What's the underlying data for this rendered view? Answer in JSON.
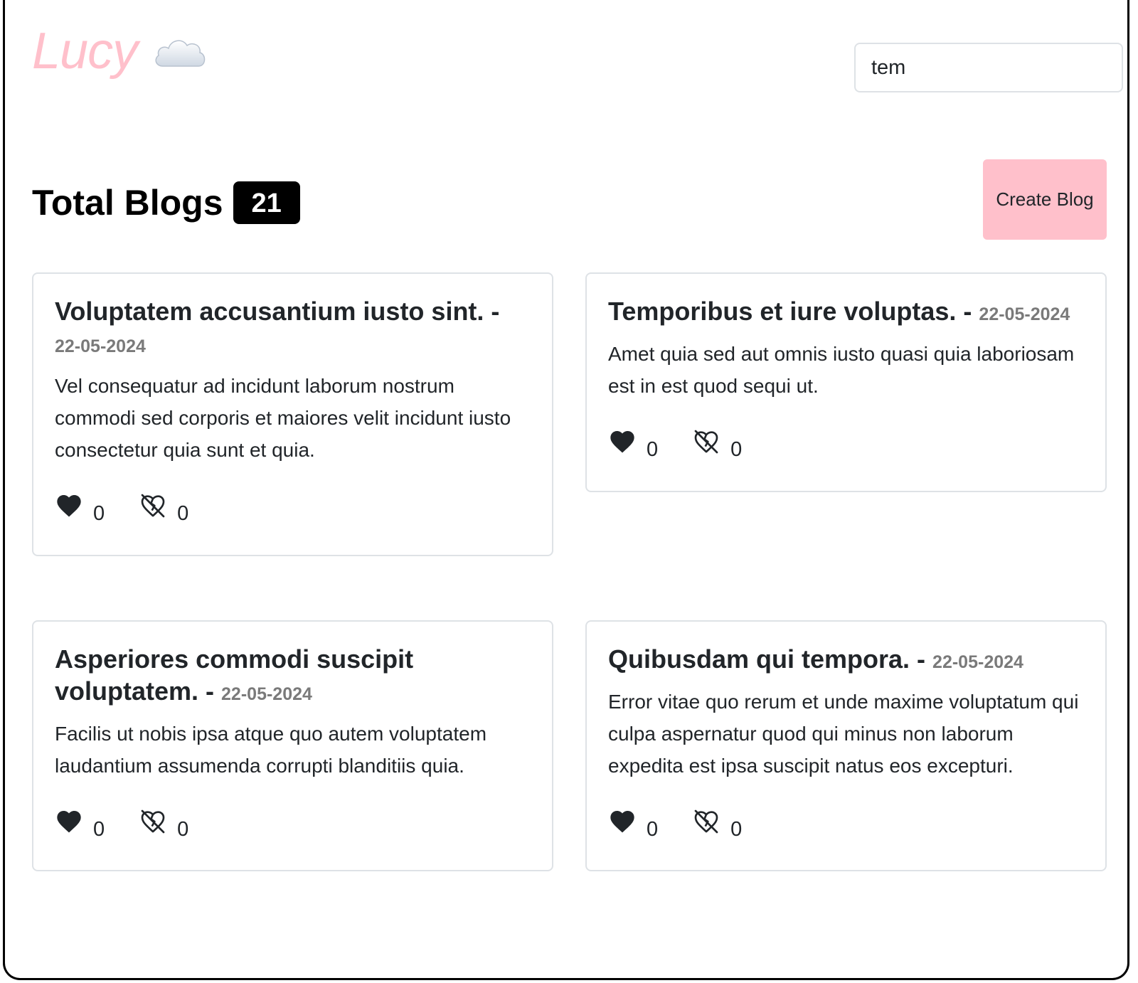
{
  "brand": {
    "name": "Lucy",
    "icon": "cloud-icon"
  },
  "search": {
    "value": "tem"
  },
  "header": {
    "title": "Total Blogs",
    "count": "21",
    "create_label": "Create Blog"
  },
  "colors": {
    "accent": "#ffc0cb",
    "badge": "#000000",
    "date": "#7a7a7a"
  },
  "blogs": [
    {
      "title": "Voluptatem accusantium iusto sint.",
      "separator": " - ",
      "date": "22-05-2024",
      "body": "Vel consequatur ad incidunt laborum nostrum commodi sed corporis et maiores velit incidunt iusto consectetur quia sunt et quia.",
      "likes": "0",
      "dislikes": "0"
    },
    {
      "title": "Temporibus et iure voluptas.",
      "separator": " - ",
      "date": "22-05-2024",
      "body": "Amet quia sed aut omnis iusto quasi quia laboriosam est in est quod sequi ut.",
      "likes": "0",
      "dislikes": "0"
    },
    {
      "title": "Asperiores commodi suscipit voluptatem.",
      "separator": " - ",
      "date": "22-05-2024",
      "body": "Facilis ut nobis ipsa atque quo autem voluptatem laudantium assumenda corrupti blanditiis quia.",
      "likes": "0",
      "dislikes": "0"
    },
    {
      "title": "Quibusdam qui tempora.",
      "separator": " - ",
      "date": "22-05-2024",
      "body": "Error vitae quo rerum et unde maxime voluptatum qui culpa aspernatur quod qui minus non laborum expedita est ipsa suscipit natus eos excepturi.",
      "likes": "0",
      "dislikes": "0"
    }
  ]
}
